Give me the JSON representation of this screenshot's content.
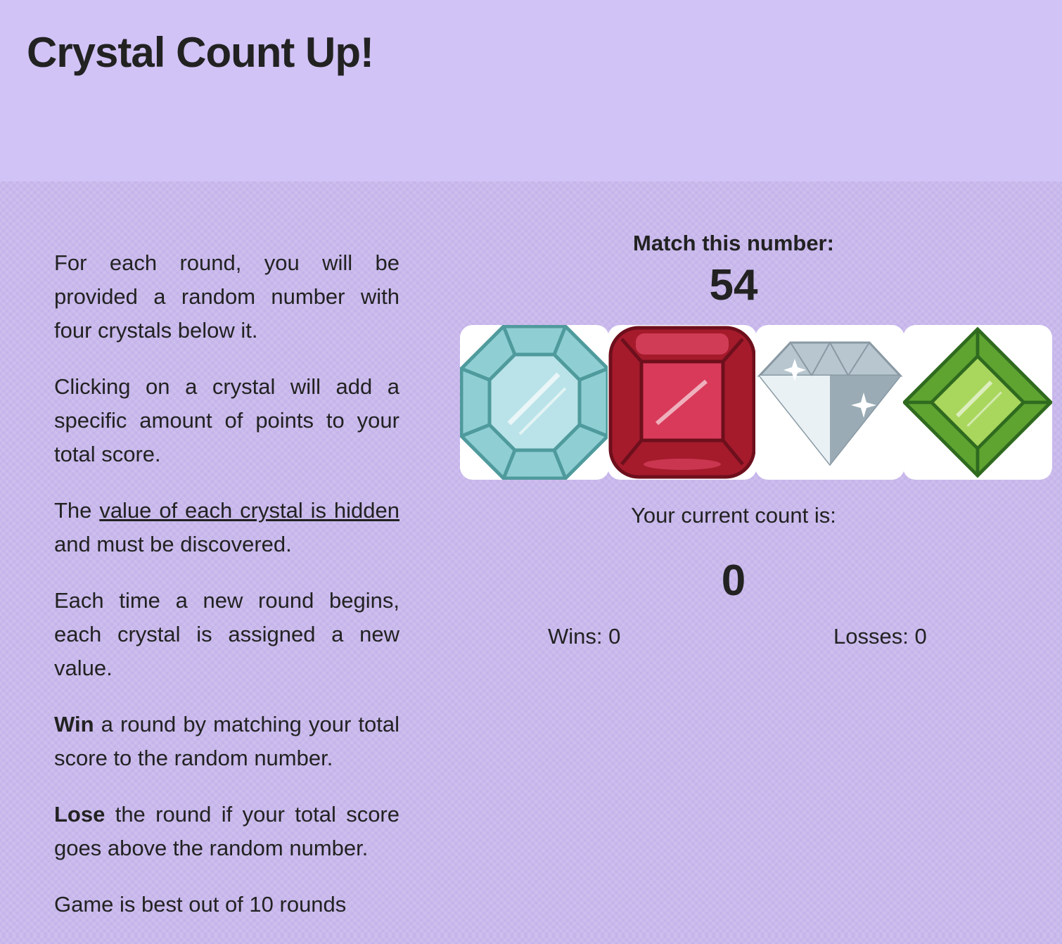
{
  "header": {
    "title": "Crystal Count Up!"
  },
  "rules": {
    "p1": "For each round, you will be provided a random number with four crystals below it.",
    "p2": "Clicking on a crystal will add a specific amount of points to your total score.",
    "p3_pre": "The ",
    "p3_link": "value of each crystal is hidden",
    "p3_post": " and must be discovered.",
    "p4": "Each time a new round begins, each crystal is assigned a new value.",
    "p5_bold": "Win",
    "p5_rest": " a round by matching your total score to the random number.",
    "p6_bold": "Lose",
    "p6_rest": " the round if your total score goes above the random number.",
    "p7": "Game is best out of 10 rounds"
  },
  "game": {
    "match_label": "Match this number:",
    "target_number": "54",
    "count_label": "Your current count is:",
    "current_count": "0",
    "wins": "Wins: 0",
    "losses": "Losses: 0",
    "crystals": [
      {
        "name": "aqua-crystal",
        "color": "#9fd4d9",
        "icon": "octagon-gem-icon"
      },
      {
        "name": "ruby-crystal",
        "color": "#c4203a",
        "icon": "square-gem-icon"
      },
      {
        "name": "diamond-crystal",
        "color": "#c9d8e2",
        "icon": "diamond-icon"
      },
      {
        "name": "emerald-crystal",
        "color": "#7bbf3b",
        "icon": "rhombus-gem-icon"
      }
    ]
  }
}
